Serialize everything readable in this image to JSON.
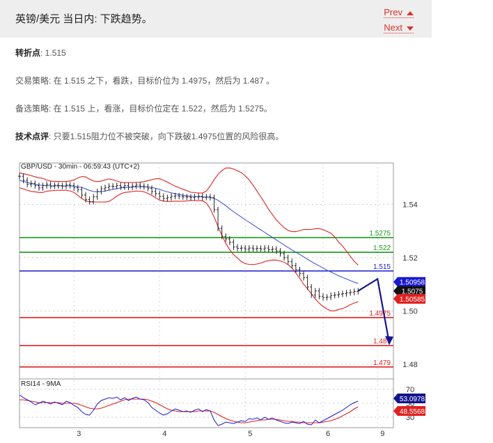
{
  "header": {
    "title": "英镑/美元 当日内: 下跌趋势。",
    "prev_label": "Prev",
    "next_label": "Next"
  },
  "article": {
    "pivot_label": "转折点",
    "pivot_value": ": 1.515",
    "strategy_label": "交易策略",
    "strategy_text": ": 在 1.515 之下，看跌，目标价位为 1.4975，然后为 1.487 。",
    "alt_label": "备选策略",
    "alt_text": ": 在 1.515 上，看涨，目标价位定在 1.522，然后为 1.5275。",
    "comment_label": "技术点评",
    "comment_text": ": 只要1.515阻力位不被突破，向下跌破1.4975位置的风险很高。"
  },
  "colors": {
    "green": "#1a9a1a",
    "blue": "#1a1ad0",
    "red": "#e02020",
    "arrow": "#14148c",
    "ma": "#3a48d8",
    "bands": "#e02020",
    "candle": "#222222"
  },
  "chart_data": {
    "type": "line",
    "title": "GBP/USD - 30min - 06:59:43 (UTC+2)",
    "x_ticks": [
      "3",
      "4",
      "5",
      "6",
      "9"
    ],
    "y_ticks": [
      "1.54",
      "1.52",
      "1.50",
      "1.48"
    ],
    "ylim": [
      1.4745,
      1.5555
    ],
    "grid": true,
    "levels": [
      {
        "label": "1.5275",
        "value": 1.5275,
        "color": "green"
      },
      {
        "label": "1.522",
        "value": 1.522,
        "color": "green"
      },
      {
        "label": "1.515",
        "value": 1.515,
        "color": "blue"
      },
      {
        "label": "1.4975",
        "value": 1.4975,
        "color": "red"
      },
      {
        "label": "1.487",
        "value": 1.487,
        "color": "red"
      },
      {
        "label": "1.479",
        "value": 1.479,
        "color": "red"
      }
    ],
    "price_labels": [
      {
        "label": "1.50958",
        "value": 1.50958,
        "color": "blue"
      },
      {
        "label": "1.5075",
        "value": 1.5075,
        "color": "black"
      },
      {
        "label": "1.50585",
        "value": 1.50585,
        "color": "red"
      }
    ],
    "price": [
      1.5505,
      1.549,
      1.5475,
      1.5478,
      1.547,
      1.5462,
      1.547,
      1.5475,
      1.5468,
      1.5472,
      1.547,
      1.5468,
      1.5473,
      1.547,
      1.5462,
      1.5455,
      1.5435,
      1.5418,
      1.541,
      1.5428,
      1.5448,
      1.5458,
      1.5463,
      1.5468,
      1.5467,
      1.547,
      1.5465,
      1.547,
      1.5464,
      1.5468,
      1.5472,
      1.5468,
      1.5466,
      1.546,
      1.5448,
      1.544,
      1.543,
      1.5422,
      1.5425,
      1.543,
      1.5432,
      1.543,
      1.5428,
      1.5427,
      1.5425,
      1.5428,
      1.543,
      1.5426,
      1.5428,
      1.5425,
      1.538,
      1.531,
      1.528,
      1.527,
      1.5258,
      1.524,
      1.5235,
      1.5236,
      1.5232,
      1.5236,
      1.5233,
      1.5235,
      1.5232,
      1.5236,
      1.523,
      1.5232,
      1.5225,
      1.5215,
      1.52,
      1.5185,
      1.517,
      1.5155,
      1.514,
      1.5125,
      1.509,
      1.506,
      1.5075,
      1.5055,
      1.505,
      1.5052,
      1.5058,
      1.506,
      1.5063,
      1.5065,
      1.5068,
      1.507,
      1.5073,
      1.5075
    ],
    "ma": [
      1.549,
      1.5486,
      1.5482,
      1.5478,
      1.5475,
      1.5472,
      1.5471,
      1.547,
      1.5469,
      1.5469,
      1.5469,
      1.5469,
      1.5469,
      1.5469,
      1.5468,
      1.5466,
      1.5463,
      1.5458,
      1.5452,
      1.5448,
      1.5447,
      1.5448,
      1.545,
      1.5453,
      1.5456,
      1.5459,
      1.5461,
      1.5463,
      1.5464,
      1.5465,
      1.5466,
      1.5466,
      1.5466,
      1.5465,
      1.5463,
      1.546,
      1.5456,
      1.5451,
      1.5447,
      1.5443,
      1.544,
      1.5437,
      1.5434,
      1.5432,
      1.543,
      1.5429,
      1.5428,
      1.5428,
      1.5427,
      1.5426,
      1.5422,
      1.5415,
      1.5405,
      1.5395,
      1.5383,
      1.5372,
      1.5362,
      1.5352,
      1.5342,
      1.5333,
      1.5323,
      1.5313,
      1.5304,
      1.5295,
      1.5285,
      1.5276,
      1.5266,
      1.5257,
      1.5247,
      1.5238,
      1.5229,
      1.522,
      1.5212,
      1.5203,
      1.5194,
      1.5185,
      1.5177,
      1.5169,
      1.5161,
      1.5153,
      1.5146,
      1.5139,
      1.5132,
      1.5126,
      1.512,
      1.5114,
      1.5108,
      1.5103
    ],
    "forecast": [
      {
        "x": 87,
        "y": 1.5075
      },
      {
        "x": 92,
        "y": 1.512
      },
      {
        "x": 95,
        "y": 1.488
      }
    ],
    "rsi": {
      "label": "RSI14 - 9MA",
      "ticks": [
        "70",
        "50",
        "30"
      ],
      "ylim": [
        15,
        85
      ],
      "values_label": "53.0978",
      "ma_label": "48.5568",
      "values": [
        62,
        58,
        55,
        52,
        48,
        50,
        53,
        51,
        49,
        52,
        50,
        48,
        53,
        51,
        47,
        44,
        38,
        34,
        33,
        40,
        49,
        54,
        56,
        58,
        57,
        59,
        55,
        58,
        54,
        57,
        59,
        56,
        55,
        51,
        44,
        40,
        36,
        33,
        35,
        39,
        42,
        40,
        38,
        39,
        37,
        40,
        42,
        38,
        41,
        39,
        26,
        18,
        20,
        23,
        22,
        21,
        23,
        25,
        24,
        28,
        27,
        29,
        26,
        30,
        27,
        29,
        26,
        24,
        22,
        21,
        23,
        22,
        21,
        24,
        20,
        19,
        26,
        22,
        25,
        28,
        31,
        34,
        37,
        40,
        44,
        48,
        51,
        53
      ],
      "ma_values": [
        55,
        55,
        54,
        53,
        52,
        51,
        51,
        51,
        51,
        51,
        51,
        50,
        50,
        50,
        50,
        49,
        47,
        45,
        43,
        42,
        42,
        43,
        45,
        47,
        49,
        51,
        53,
        55,
        56,
        56,
        56,
        56,
        56,
        55,
        53,
        51,
        48,
        45,
        42,
        40,
        39,
        38,
        38,
        38,
        38,
        38,
        39,
        39,
        39,
        39,
        37,
        34,
        31,
        28,
        26,
        24,
        23,
        22,
        22,
        23,
        24,
        25,
        26,
        26,
        27,
        27,
        27,
        26,
        25,
        24,
        24,
        23,
        23,
        22,
        22,
        22,
        22,
        22,
        23,
        24,
        25,
        27,
        29,
        32,
        35,
        38,
        42,
        45
      ]
    }
  }
}
